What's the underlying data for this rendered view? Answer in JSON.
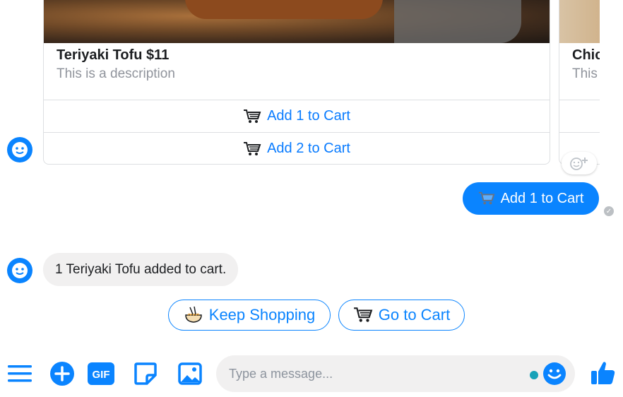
{
  "card": {
    "title": "Teriyaki Tofu $11",
    "description": "This is a description",
    "buttons": [
      "Add 1 to Cart",
      "Add 2 to Cart"
    ]
  },
  "card_next": {
    "title": "Chic",
    "description": "This"
  },
  "messages": {
    "user_reply": "Add 1 to Cart",
    "bot_reply": "1 Teriyaki Tofu added to cart."
  },
  "quick_replies": [
    {
      "label": "Keep Shopping",
      "icon": "noodle-bowl-icon"
    },
    {
      "label": "Go to Cart",
      "icon": "cart-icon"
    }
  ],
  "composer": {
    "placeholder": "Type a message...",
    "gif_label": "GIF"
  },
  "colors": {
    "accent": "#0a84ff",
    "link": "#0a7cff",
    "bubble_gray": "#f1f0f0",
    "border": "#dddfe2"
  }
}
